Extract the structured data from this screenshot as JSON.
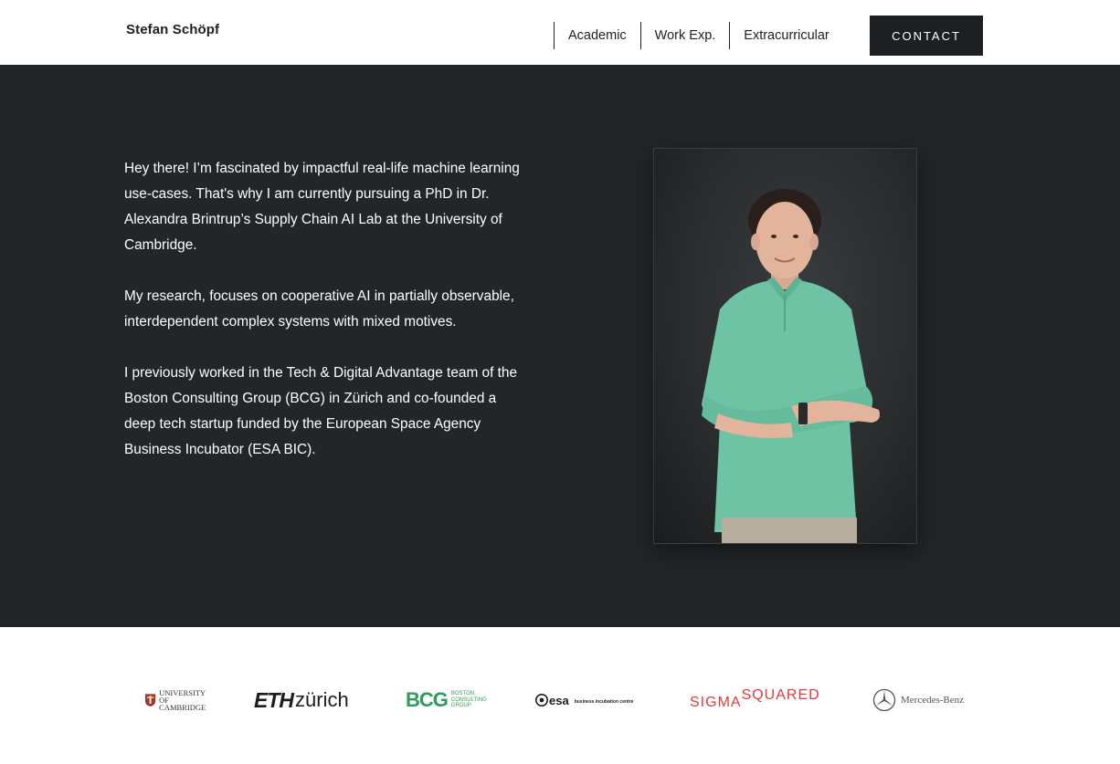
{
  "header": {
    "brand": "Stefan Schöpf",
    "nav": [
      {
        "label": "Academic"
      },
      {
        "label": "Work Exp."
      },
      {
        "label": "Extracurricular"
      }
    ],
    "contact_label": "CONTACT"
  },
  "hero": {
    "paragraphs": [
      "Hey there! I’m fascinated by impactful real-life machine learning use-cases. That's why I am currently pursuing a PhD in Dr. Alexandra Brintrup’s Supply Chain AI Lab at the University of Cambridge.",
      "My research, focuses on cooperative AI in partially observable, interdependent complex systems with mixed motives.",
      "I previously worked in the Tech & Digital Advantage team of the Boston Consulting Group (BCG) in Zürich and co-founded a deep tech startup funded by the European Space Agency Business Incubator (ESA BIC)."
    ]
  },
  "logos": {
    "cambridge": {
      "line1": "UNIVERSITY OF",
      "line2": "CAMBRIDGE"
    },
    "eth": {
      "bold": "ETH",
      "light": "zürich"
    },
    "bcg": {
      "mark": "BCG",
      "line1": "BOSTON",
      "line2": "CONSULTING",
      "line3": "GROUP"
    },
    "esa": {
      "mark": "esa",
      "tagline": "business incubation centre"
    },
    "sigma": {
      "left": "SIGMA",
      "right": "SQUARED"
    },
    "mercedes": {
      "text": "Mercedes-Benz"
    }
  },
  "colors": {
    "dark": "#1d2022",
    "hero_bg": "#222628",
    "bcg_green": "#2d9c5a",
    "sigma_red": "#e23b3b",
    "cambridge_red": "#a3352b"
  }
}
